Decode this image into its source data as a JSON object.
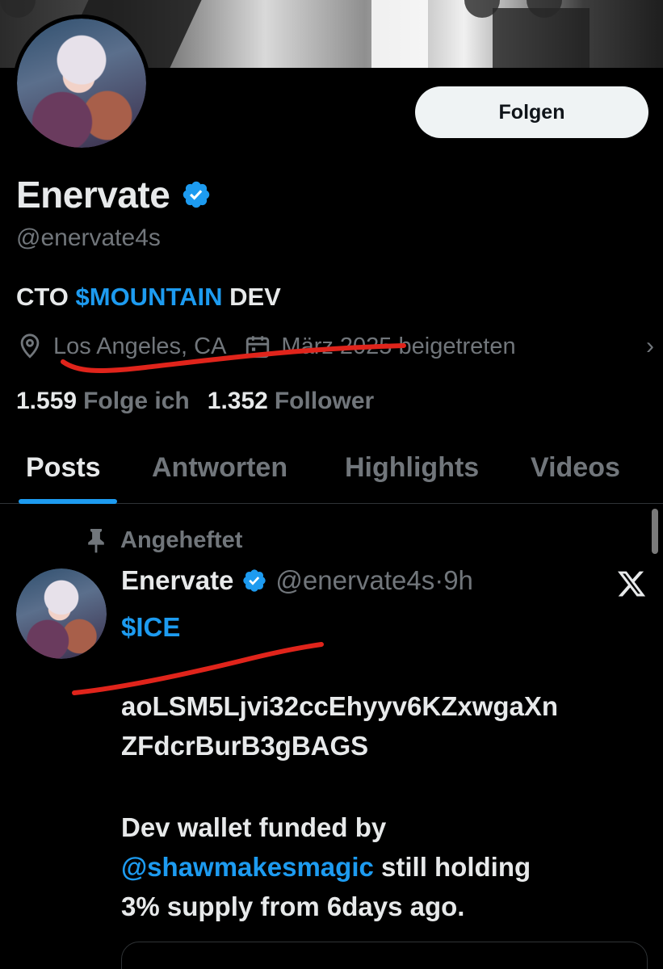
{
  "profile": {
    "follow_label": "Folgen",
    "display_name": "Enervate",
    "handle": "@enervate4s",
    "bio_prefix": "CTO ",
    "bio_link": "$MOUNTAIN",
    "bio_suffix": " DEV",
    "location": "Los Angeles, CA",
    "joined": "März 2025 beigetreten",
    "following_count": "1.559",
    "following_label": "Folge ich",
    "followers_count": "1.352",
    "followers_label": "Follower"
  },
  "tabs": [
    {
      "label": "Posts",
      "active": true
    },
    {
      "label": "Antworten",
      "active": false
    },
    {
      "label": "Highlights",
      "active": false
    },
    {
      "label": "Videos",
      "active": false
    }
  ],
  "post": {
    "pinned_label": "Angeheftet",
    "author_name": "Enervate",
    "author_handle": "@enervate4s",
    "separator": "·",
    "time": "9h",
    "ticker": "$ICE",
    "address_line1": "aoLSM5Ljvi32ccEhyyv6KZxwgaXn",
    "address_line2": "ZFdcrBurB3gBAGS",
    "text_line1": "Dev wallet funded by",
    "mention": "@shawmakesmagic",
    "text_line2_suffix": " still holding",
    "text_line3": "3% supply from 6days ago."
  },
  "icons": {
    "verified": "verified-badge-icon",
    "location": "location-pin-icon",
    "calendar": "calendar-icon",
    "pin": "pin-icon",
    "x_logo": "x-logo-icon",
    "chevron": "chevron-right-icon"
  },
  "colors": {
    "accent": "#1d9bf0",
    "muted": "#71767b",
    "annotation_red": "#e0241b"
  }
}
